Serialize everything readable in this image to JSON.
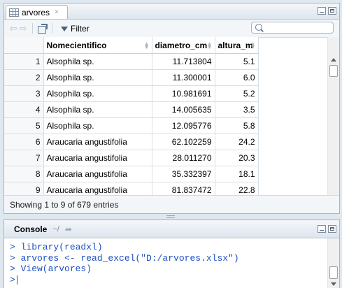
{
  "viewer": {
    "tab_title": "arvores",
    "tab_close": "×",
    "filter_label": "Filter",
    "search_placeholder": "",
    "status": "Showing 1 to 9 of 679 entries"
  },
  "table": {
    "columns": [
      "",
      "Nomecientifico",
      "diametro_cm",
      "altura_m"
    ],
    "rows": [
      [
        "1",
        "Alsophila sp.",
        "11.713804",
        "5.1"
      ],
      [
        "2",
        "Alsophila sp.",
        "11.300001",
        "6.0"
      ],
      [
        "3",
        "Alsophila sp.",
        "10.981691",
        "5.2"
      ],
      [
        "4",
        "Alsophila sp.",
        "14.005635",
        "3.5"
      ],
      [
        "5",
        "Alsophila sp.",
        "12.095776",
        "5.8"
      ],
      [
        "6",
        "Araucaria angustifolia",
        "62.102259",
        "24.2"
      ],
      [
        "7",
        "Araucaria angustifolia",
        "28.011270",
        "20.3"
      ],
      [
        "8",
        "Araucaria angustifolia",
        "35.332397",
        "18.1"
      ],
      [
        "9",
        "Araucaria angustifolia",
        "81.837472",
        "22.8"
      ]
    ]
  },
  "console": {
    "title": "Console",
    "path": "~/",
    "lines": [
      "> library(readxl)",
      "> arvores <- read_excel(\"D:/arvores.xlsx\")",
      "> View(arvores)",
      ">"
    ]
  }
}
